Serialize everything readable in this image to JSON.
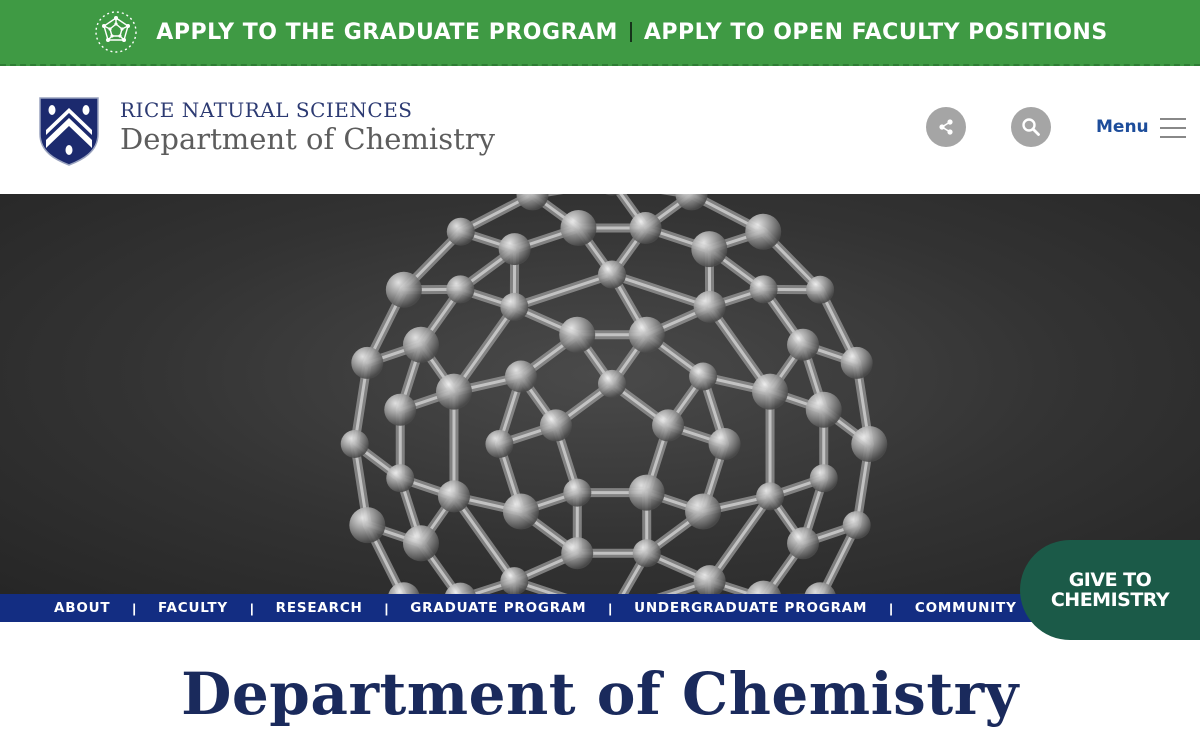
{
  "top_banner": {
    "graduate_link": "APPLY TO THE GRADUATE PROGRAM",
    "faculty_link": "APPLY TO OPEN FACULTY POSITIONS",
    "icon": "molecule-icon",
    "background_color": "#3f9a44"
  },
  "header": {
    "brand_top": "RICE NATURAL SCIENCES",
    "brand_main": "Department of Chemistry",
    "logo_icon": "rice-shield-icon",
    "share_icon": "share-icon",
    "search_icon": "search-icon",
    "menu_label": "Menu",
    "menu_icon": "hamburger-icon"
  },
  "hero": {
    "image": "buckminsterfullerene-molecule"
  },
  "nav": {
    "items": [
      "ABOUT",
      "FACULTY",
      "RESEARCH",
      "GRADUATE PROGRAM",
      "UNDERGRADUATE PROGRAM",
      "COMMUNITY"
    ],
    "background_color": "#132d82"
  },
  "give": {
    "line1": "GIVE TO",
    "line2": "CHEMISTRY",
    "background_color": "#1b5a48"
  },
  "main": {
    "title": "Department of Chemistry"
  }
}
